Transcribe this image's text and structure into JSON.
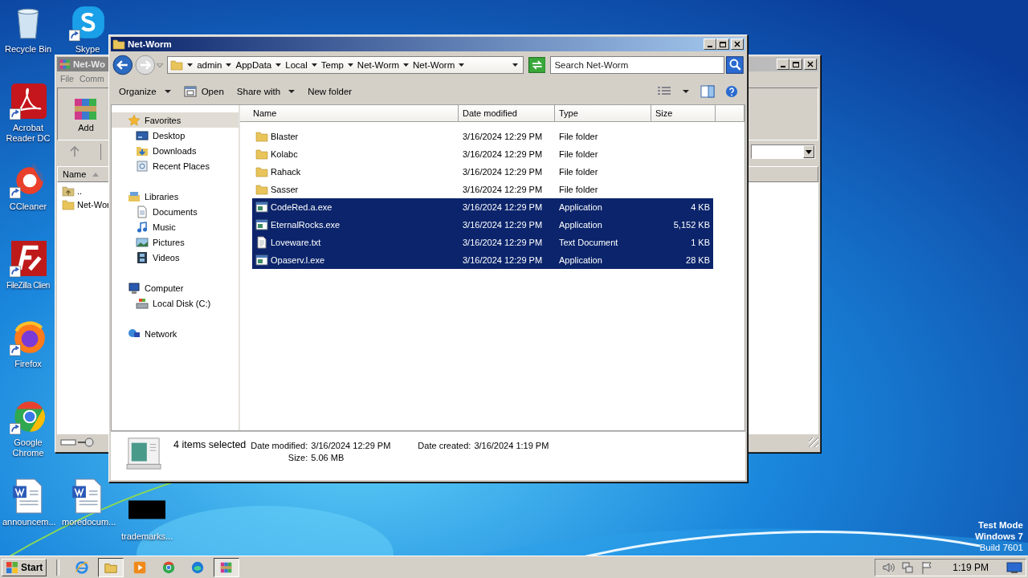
{
  "desktop": {
    "icons": [
      {
        "kind": "recycle-bin",
        "label": "Recycle Bin"
      },
      {
        "kind": "skype",
        "label": "Skype"
      },
      {
        "kind": "acrobat",
        "label": "Acrobat Reader DC"
      },
      {
        "kind": "ccleaner",
        "label": "CCleaner"
      },
      {
        "kind": "filezilla",
        "label": "FileZilla Clien"
      },
      {
        "kind": "firefox",
        "label": "Firefox"
      },
      {
        "kind": "chrome",
        "label": "Google Chrome"
      },
      {
        "kind": "word-doc",
        "label": "announcem..."
      },
      {
        "kind": "word-doc",
        "label": "moredocum..."
      },
      {
        "kind": "black-thumbnail",
        "label": "trademarks..."
      }
    ],
    "os_notice": [
      "Test Mode",
      "Windows 7",
      "Build 7601"
    ]
  },
  "background_window": {
    "title": "Net-Wo",
    "menu": [
      "File",
      "Comm"
    ],
    "toolbar": [
      "Add"
    ],
    "column": "Name",
    "rows": [
      {
        "name": "..",
        "kind": "up"
      },
      {
        "name": "Net-Wor",
        "kind": "folder"
      }
    ]
  },
  "explorer": {
    "title": "Net-Worm",
    "breadcrumb": [
      "admin",
      "AppData",
      "Local",
      "Temp",
      "Net-Worm",
      "Net-Worm"
    ],
    "search": {
      "placeholder": "Search Net-Worm"
    },
    "toolbar": [
      {
        "label": "Organize",
        "kind": "menu"
      },
      {
        "label": "Open",
        "kind": "open"
      },
      {
        "label": "Share with",
        "kind": "menu"
      },
      {
        "label": "New folder",
        "kind": "plain"
      }
    ],
    "nav": [
      {
        "label": "Favorites",
        "kind": "star",
        "selected": true,
        "children": [
          {
            "label": "Desktop",
            "kind": "desktop",
            "selected": false
          },
          {
            "label": "Downloads",
            "kind": "downloads",
            "selected": false
          },
          {
            "label": "Recent Places",
            "kind": "recent",
            "selected": false
          }
        ]
      },
      {
        "label": "Libraries",
        "kind": "libraries",
        "selected": false,
        "children": [
          {
            "label": "Documents",
            "kind": "documents",
            "selected": false
          },
          {
            "label": "Music",
            "kind": "music",
            "selected": false
          },
          {
            "label": "Pictures",
            "kind": "pictures",
            "selected": false
          },
          {
            "label": "Videos",
            "kind": "videos",
            "selected": false
          }
        ]
      },
      {
        "label": "Computer",
        "kind": "computer",
        "selected": false,
        "children": [
          {
            "label": "Local Disk (C:)",
            "kind": "disk",
            "selected": false
          }
        ]
      },
      {
        "label": "Network",
        "kind": "network",
        "selected": false
      }
    ],
    "columns": [
      "Name",
      "Date modified",
      "Type",
      "Size"
    ],
    "files": [
      {
        "name": "Blaster",
        "date": "3/16/2024 12:29 PM",
        "type": "File folder",
        "kind": "folder",
        "selected": false
      },
      {
        "name": "Kolabc",
        "date": "3/16/2024 12:29 PM",
        "type": "File folder",
        "kind": "folder",
        "selected": false
      },
      {
        "name": "Rahack",
        "date": "3/16/2024 12:29 PM",
        "type": "File folder",
        "kind": "folder",
        "selected": false
      },
      {
        "name": "Sasser",
        "date": "3/16/2024 12:29 PM",
        "type": "File folder",
        "kind": "folder",
        "selected": false
      },
      {
        "name": "CodeRed.a.exe",
        "date": "3/16/2024 12:29 PM",
        "type": "Application",
        "size": "4 KB",
        "kind": "exe",
        "selected": true
      },
      {
        "name": "EternalRocks.exe",
        "date": "3/16/2024 12:29 PM",
        "type": "Application",
        "size": "5,152 KB",
        "kind": "exe",
        "selected": true
      },
      {
        "name": "Loveware.txt",
        "date": "3/16/2024 12:29 PM",
        "type": "Text Document",
        "size": "1 KB",
        "kind": "txt",
        "selected": true
      },
      {
        "name": "Opaserv.l.exe",
        "date": "3/16/2024 12:29 PM",
        "type": "Application",
        "size": "28 KB",
        "kind": "exe",
        "selected": true
      }
    ],
    "details": {
      "summary": "4 items selected",
      "fields": [
        {
          "label": "Date modified:",
          "value": "3/16/2024 12:29 PM"
        },
        {
          "label": "Date created:",
          "value": "3/16/2024 1:19 PM"
        },
        {
          "label": "Size:",
          "value": "5.06 MB"
        }
      ]
    }
  },
  "taskbar": {
    "start": "Start",
    "apps": [
      {
        "kind": "ie",
        "active": false
      },
      {
        "kind": "explorer",
        "active": true
      },
      {
        "kind": "media-player",
        "active": false
      },
      {
        "kind": "chrome",
        "active": false
      },
      {
        "kind": "edge",
        "active": false
      },
      {
        "kind": "winrar",
        "active": true
      }
    ],
    "clock": "1:19 PM"
  }
}
